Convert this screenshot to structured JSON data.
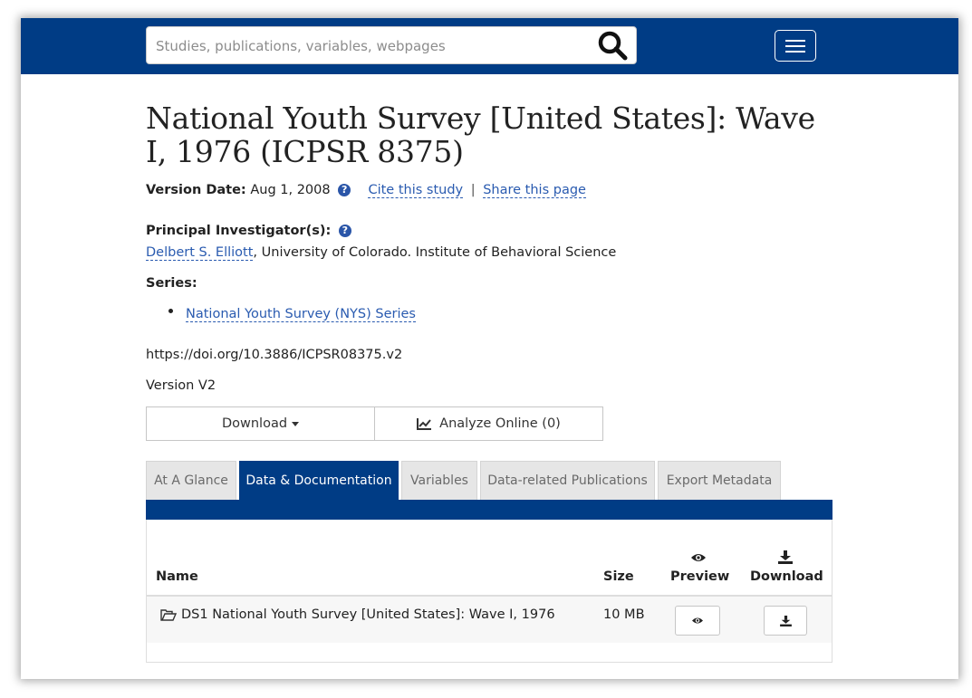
{
  "search": {
    "placeholder": "Studies, publications, variables, webpages",
    "value": ""
  },
  "study": {
    "title": "National Youth Survey [United States]: Wave I, 1976 (ICPSR 8375)",
    "version_date_label": "Version Date:",
    "version_date": "Aug 1, 2008",
    "cite_link": "Cite this study",
    "separator": "|",
    "share_link": "Share this page",
    "pi_label": "Principal Investigator(s):",
    "pi_name": "Delbert S. Elliott",
    "pi_affiliation": ", University of Colorado. Institute of Behavioral Science",
    "series_label": "Series:",
    "series_items": [
      "National Youth Survey (NYS) Series"
    ],
    "doi": "https://doi.org/10.3886/ICPSR08375.v2",
    "version": "Version V2"
  },
  "actions": {
    "download_label": "Download",
    "analyze_label": "Analyze Online (0)"
  },
  "tabs": [
    {
      "label": "At A Glance",
      "active": false
    },
    {
      "label": "Data & Documentation",
      "active": true
    },
    {
      "label": "Variables",
      "active": false
    },
    {
      "label": "Data-related Publications",
      "active": false
    },
    {
      "label": "Export Metadata",
      "active": false
    }
  ],
  "table": {
    "headers": {
      "name": "Name",
      "size": "Size",
      "preview": "Preview",
      "download": "Download"
    },
    "rows": [
      {
        "name": "DS1 National Youth Survey [United States]: Wave I, 1976",
        "size": "10 MB"
      }
    ]
  },
  "colors": {
    "header_bg": "#003c85",
    "link": "#2a5bb0",
    "tab_inactive": "#e6e6e6"
  },
  "icons": {
    "search": "magnifier-icon",
    "menu": "hamburger-icon",
    "help": "question-circle-icon",
    "analyze": "line-chart-icon",
    "folder": "folder-open-icon",
    "preview": "eye-icon",
    "download": "download-icon"
  }
}
